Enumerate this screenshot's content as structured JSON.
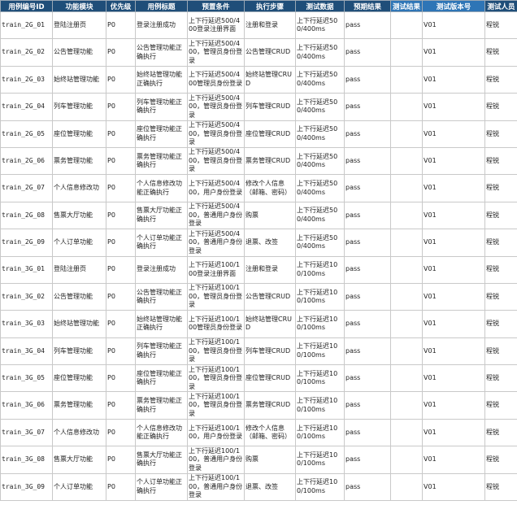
{
  "columns": [
    "用例编号ID",
    "功能模块",
    "优先级",
    "用例标题",
    "预置条件",
    "执行步骤",
    "测试数据",
    "预期结果",
    "测试结果",
    "测试版本号",
    "测试人员"
  ],
  "rows": [
    {
      "id": "train_2G_01",
      "module": "登陆注册页",
      "priority": "P0",
      "title": "登录注册成功",
      "precondition": "上下行延迟500/400登录注册界面",
      "steps": "注册和登录",
      "data": "上下行延迟500/400ms",
      "expected": "pass",
      "result": "",
      "version": "V01",
      "tester": "程锐"
    },
    {
      "id": "train_2G_02",
      "module": "公告管理功能",
      "priority": "P0",
      "title": "公告管理功能正确执行",
      "precondition": "上下行延迟500/400，管理员身份登录",
      "steps": "公告管理CRUD",
      "data": "上下行延迟500/400ms",
      "expected": "pass",
      "result": "",
      "version": "V01",
      "tester": "程锐"
    },
    {
      "id": "train_2G_03",
      "module": "始终站管理功能",
      "priority": "P0",
      "title": "始终站管理功能正确执行",
      "precondition": "上下行延迟500/400管理员身份登录",
      "steps": "始终站管理CRUD",
      "data": "上下行延迟500/400ms",
      "expected": "pass",
      "result": "",
      "version": "V01",
      "tester": "程锐"
    },
    {
      "id": "train_2G_04",
      "module": "列车管理功能",
      "priority": "P0",
      "title": "列车管理功能正确执行",
      "precondition": "上下行延迟500/400，管理员身份登录",
      "steps": "列车管理CRUD",
      "data": "上下行延迟500/400ms",
      "expected": "pass",
      "result": "",
      "version": "V01",
      "tester": "程锐"
    },
    {
      "id": "train_2G_05",
      "module": "座位管理功能",
      "priority": "P0",
      "title": "座位管理功能正确执行",
      "precondition": "上下行延迟500/400，管理员身份登录",
      "steps": "座位管理CRUD",
      "data": "上下行延迟500/400ms",
      "expected": "pass",
      "result": "",
      "version": "V01",
      "tester": "程锐"
    },
    {
      "id": "train_2G_06",
      "module": "票务管理功能",
      "priority": "P0",
      "title": "票务管理功能正确执行",
      "precondition": "上下行延迟500/400，管理员身份登录",
      "steps": "票务管理CRUD",
      "data": "上下行延迟500/400ms",
      "expected": "pass",
      "result": "",
      "version": "V01",
      "tester": "程锐"
    },
    {
      "id": "train_2G_07",
      "module": "个人信息修改功",
      "priority": "P0",
      "title": "个人信息修改功能正确执行",
      "precondition": "上下行延迟500/400，用户身份登录",
      "steps": "修改个人信息（邮箱、密码）",
      "data": "上下行延迟500/400ms",
      "expected": "pass",
      "result": "",
      "version": "V01",
      "tester": "程锐"
    },
    {
      "id": "train_2G_08",
      "module": "售票大厅功能",
      "priority": "P0",
      "title": "售票大厅功能正确执行",
      "precondition": "上下行延迟500/400，普通用户身份登录",
      "steps": "购票",
      "data": "上下行延迟500/400ms",
      "expected": "pass",
      "result": "",
      "version": "V01",
      "tester": "程锐"
    },
    {
      "id": "train_2G_09",
      "module": "个人订单功能",
      "priority": "P0",
      "title": "个人订单功能正确执行",
      "precondition": "上下行延迟500/400，普通用户身份登录",
      "steps": "退票、改签",
      "data": "上下行延迟500/400ms",
      "expected": "pass",
      "result": "",
      "version": "V01",
      "tester": "程锐"
    },
    {
      "id": "train_3G_01",
      "module": "登陆注册页",
      "priority": "P0",
      "title": "登录注册成功",
      "precondition": "上下行延迟100/100登录注册界面",
      "steps": "注册和登录",
      "data": "上下行延迟100/100ms",
      "expected": "pass",
      "result": "",
      "version": "V01",
      "tester": "程锐"
    },
    {
      "id": "train_3G_02",
      "module": "公告管理功能",
      "priority": "P0",
      "title": "公告管理功能正确执行",
      "precondition": "上下行延迟100/100，管理员身份登录",
      "steps": "公告管理CRUD",
      "data": "上下行延迟100/100ms",
      "expected": "pass",
      "result": "",
      "version": "V01",
      "tester": "程锐"
    },
    {
      "id": "train_3G_03",
      "module": "始终站管理功能",
      "priority": "P0",
      "title": "始终站管理功能正确执行",
      "precondition": "上下行延迟100/100管理员身份登录",
      "steps": "始终站管理CRUD",
      "data": "上下行延迟100/100ms",
      "expected": "pass",
      "result": "",
      "version": "V01",
      "tester": "程锐"
    },
    {
      "id": "train_3G_04",
      "module": "列车管理功能",
      "priority": "P0",
      "title": "列车管理功能正确执行",
      "precondition": "上下行延迟100/100，管理员身份登录",
      "steps": "列车管理CRUD",
      "data": "上下行延迟100/100ms",
      "expected": "pass",
      "result": "",
      "version": "V01",
      "tester": "程锐"
    },
    {
      "id": "train_3G_05",
      "module": "座位管理功能",
      "priority": "P0",
      "title": "座位管理功能正确执行",
      "precondition": "上下行延迟100/100，管理员身份登录",
      "steps": "座位管理CRUD",
      "data": "上下行延迟100/100ms",
      "expected": "pass",
      "result": "",
      "version": "V01",
      "tester": "程锐"
    },
    {
      "id": "train_3G_06",
      "module": "票务管理功能",
      "priority": "P0",
      "title": "票务管理功能正确执行",
      "precondition": "上下行延迟100/100，管理员身份登录",
      "steps": "票务管理CRUD",
      "data": "上下行延迟100/100ms",
      "expected": "pass",
      "result": "",
      "version": "V01",
      "tester": "程锐"
    },
    {
      "id": "train_3G_07",
      "module": "个人信息修改功",
      "priority": "P0",
      "title": "个人信息修改功能正确执行",
      "precondition": "上下行延迟100/100，用户身份登录",
      "steps": "修改个人信息（邮箱、密码）",
      "data": "上下行延迟100/100ms",
      "expected": "pass",
      "result": "",
      "version": "V01",
      "tester": "程锐"
    },
    {
      "id": "train_3G_08",
      "module": "售票大厅功能",
      "priority": "P0",
      "title": "售票大厅功能正确执行",
      "precondition": "上下行延迟100/100，普通用户身份登录",
      "steps": "购票",
      "data": "上下行延迟100/100ms",
      "expected": "pass",
      "result": "",
      "version": "V01",
      "tester": "程锐"
    },
    {
      "id": "train_3G_09",
      "module": "个人订单功能",
      "priority": "P0",
      "title": "个人订单功能正确执行",
      "precondition": "上下行延迟100/100，普通用户身份登录",
      "steps": "退票、改签",
      "data": "上下行延迟100/100ms",
      "expected": "pass",
      "result": "",
      "version": "V01",
      "tester": "程锐"
    }
  ],
  "colors": {
    "header": "#1f4e79",
    "header_alt": "#2e75b6",
    "grid": "#c9c9c9"
  }
}
